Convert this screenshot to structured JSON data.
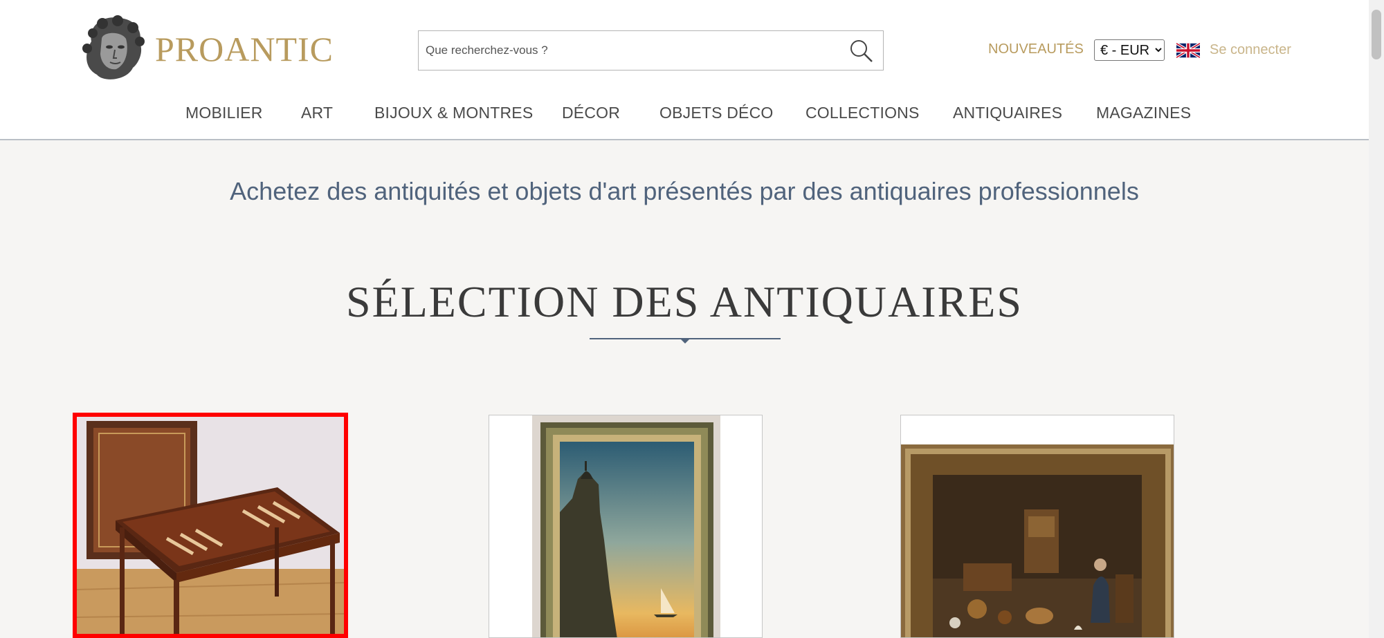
{
  "header": {
    "brand": "PROANTIC",
    "search_placeholder": "Que recherchez-vous ?",
    "new_link": "NOUVEAUTÉS",
    "currency": "€ - EUR",
    "login": "Se connecter"
  },
  "nav": {
    "items": [
      "MOBILIER",
      "ART",
      "BIJOUX & MONTRES",
      "DÉCOR",
      "OBJETS DÉCO",
      "COLLECTIONS",
      "ANTIQUAIRES",
      "MAGAZINES"
    ]
  },
  "main": {
    "tagline": "Achetez des antiquités et objets d'art présentés par des antiquaires professionnels",
    "section_title": "SÉLECTION DES ANTIQUAIRES"
  },
  "colors": {
    "gold": "#b89b5e",
    "nav_text": "#4a4a4a",
    "tagline": "#50637c",
    "highlight": "#ff0000"
  },
  "icons": [
    "bust-logo-icon",
    "search-icon",
    "uk-flag-icon",
    "divider-arrow-icon"
  ],
  "cards": [
    {
      "subject": "backgammon-table-image",
      "selected": true
    },
    {
      "subject": "framed-seascape-painting-image",
      "selected": false
    },
    {
      "subject": "framed-interior-painting-image",
      "selected": false
    }
  ]
}
